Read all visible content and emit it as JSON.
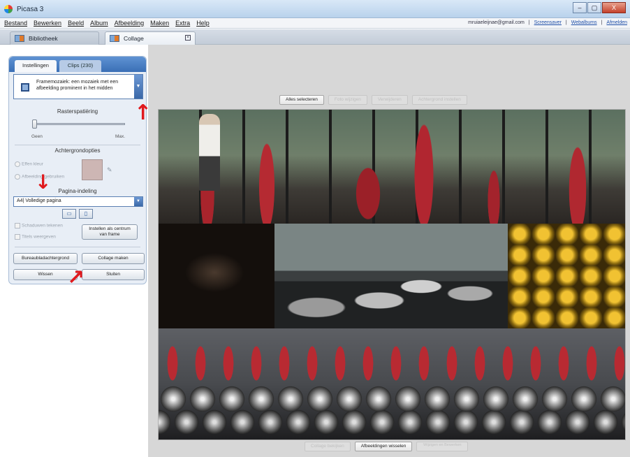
{
  "window": {
    "title": "Picasa 3",
    "controls": [
      "–",
      "▢",
      "X"
    ]
  },
  "menubar": {
    "items": [
      "Bestand",
      "Bewerken",
      "Beeld",
      "Album",
      "Afbeelding",
      "Maken",
      "Extra",
      "Help"
    ],
    "account_email": "mruiaeleijnae@gmail.com",
    "separator": "|",
    "links": [
      "Screensaver",
      "Webalbums",
      "Afmelden"
    ]
  },
  "tabs": {
    "library_label": "Bibliotheek",
    "collage_label": "Collage",
    "collage_close": "×"
  },
  "settings_panel": {
    "tabs": [
      "Instellingen",
      "Clips (230)"
    ],
    "collage_type": {
      "text": "Framemozaiek: een mozaiek met een afbeelding prominent in het midden",
      "icon": "framemosaic-icon",
      "dropdown_glyph": "▼"
    },
    "grid_spacing": {
      "title": "Rasterspatiëring",
      "min_label": "Geen",
      "max_label": "Max."
    },
    "background": {
      "title": "Achtergrondopties",
      "option_solid": "Effen kleur",
      "option_image": "Afbeelding gebruiken",
      "swatch_color": "#cdb6b4"
    },
    "page_format": {
      "title": "Pagina-indeling",
      "selected": "A4| Volledige pagina",
      "landscape_glyph": "▭",
      "portrait_glyph": "▯"
    },
    "checkboxes": [
      "Schaduwen tekenen",
      "Titels weergeven"
    ],
    "buttons": {
      "center_frame": [
        "Instellen als centrum",
        "van frame"
      ],
      "desktop_background": "Bureaubladachtergrond",
      "make_collage": "Collage maken",
      "clear": "Wissen",
      "close": "Sluiten"
    }
  },
  "stage": {
    "top_buttons": [
      "Alles selecteren",
      "Foto wijzigen",
      "Verwijderen",
      "Achtergrond instellen"
    ],
    "bottom_buttons": [
      "Collage bekijken",
      "Afbeeldingen wisselen",
      "Wijzigen en Bewerken"
    ],
    "background_color": "#d7d7d7"
  },
  "annotations": {
    "arrow_color": "#e0191d",
    "up": "↑",
    "down": "↓",
    "diag": "↗"
  }
}
